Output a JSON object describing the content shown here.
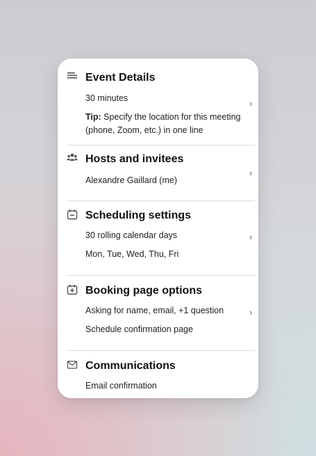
{
  "event_details": {
    "title": "Event Details",
    "duration": "30 minutes",
    "tip_label": "Tip:",
    "tip_text": " Specify the location for this meeting (phone, Zoom, etc.) in one line",
    "icon": "text-lines-icon"
  },
  "hosts": {
    "title": "Hosts and invitees",
    "host": "Alexandre Gaillard (me)",
    "icon": "people-icon"
  },
  "scheduling": {
    "title": "Scheduling settings",
    "range": "30 rolling calendar days",
    "days": "Mon, Tue, Wed, Thu, Fri",
    "icon": "calendar-minus-icon"
  },
  "booking": {
    "title": "Booking page options",
    "questions": "Asking for name, email, +1 question",
    "confirmation": "Schedule confirmation page",
    "icon": "calendar-plus-icon"
  },
  "communications": {
    "title": "Communications",
    "email": "Email confirmation",
    "icon": "envelope-icon"
  },
  "chevron_glyph": "›"
}
